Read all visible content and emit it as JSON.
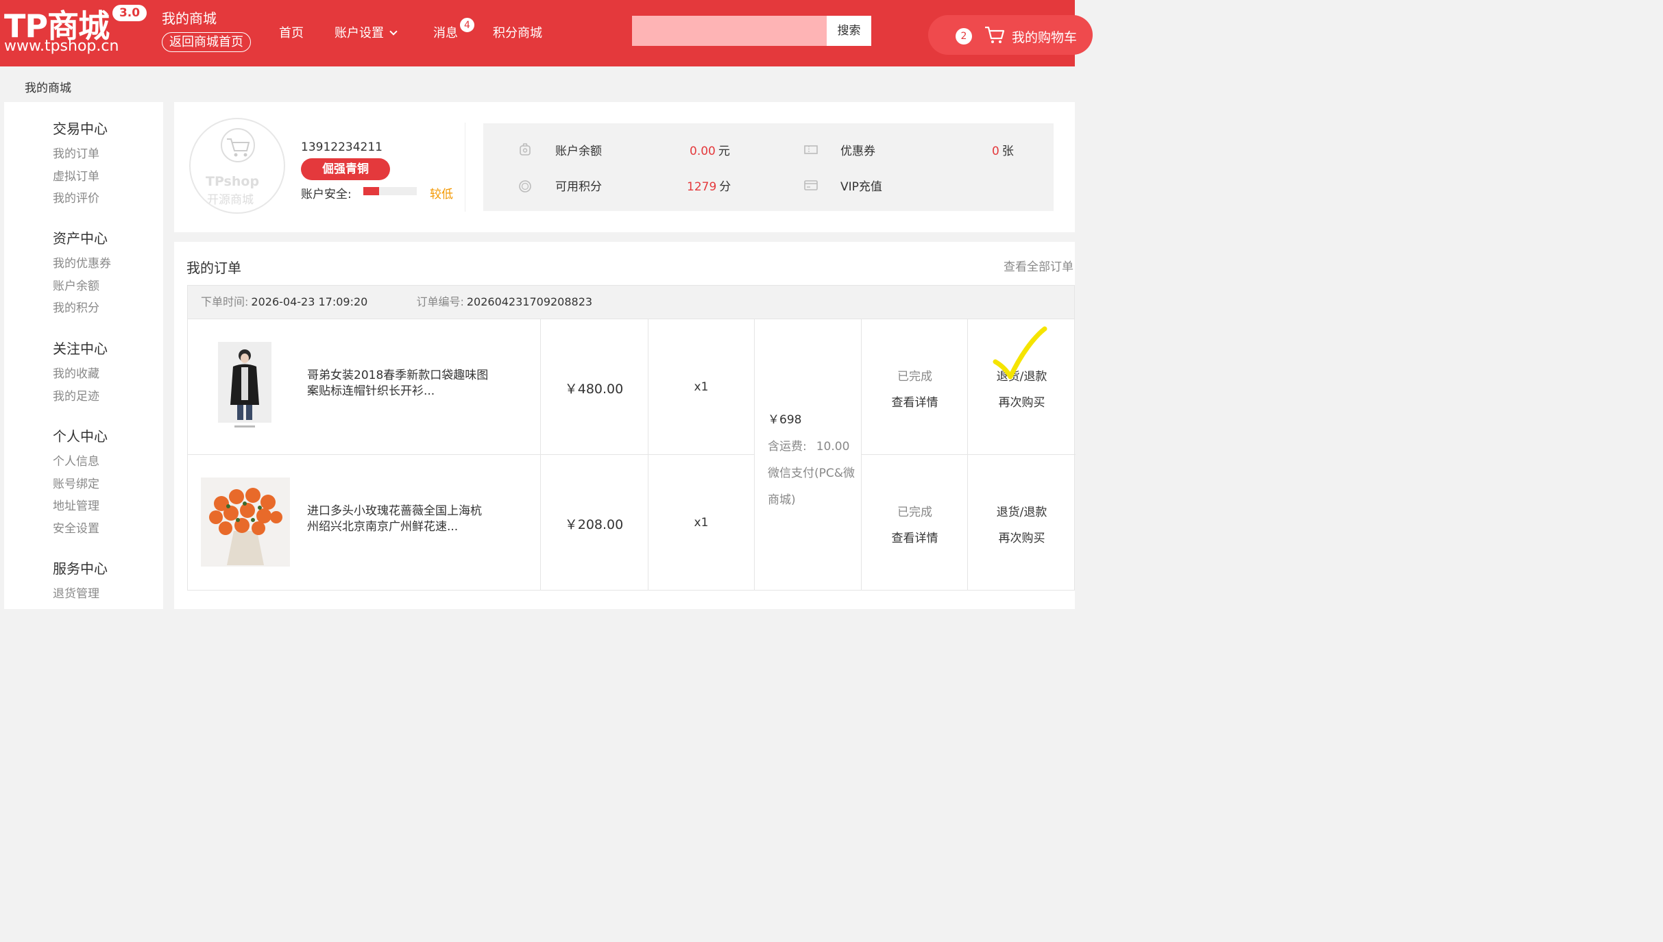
{
  "header": {
    "logo_text": "TP商城",
    "logo_version": "3.0",
    "logo_url": "www.tpshop.cn",
    "mall_title": "我的商城",
    "back_home": "返回商城首页",
    "nav": [
      {
        "label": "首页"
      },
      {
        "label": "账户设置"
      },
      {
        "label": "消息",
        "badge": "4"
      },
      {
        "label": "积分商城"
      }
    ],
    "search": {
      "placeholder": "",
      "button": "搜索"
    },
    "cart": {
      "count": "2",
      "label": "我的购物车"
    },
    "brand_color": "#e4393c"
  },
  "breadcrumb": "我的商城",
  "sidebar": {
    "groups": [
      {
        "title": "交易中心",
        "items": [
          "我的订单",
          "虚拟订单",
          "我的评价"
        ]
      },
      {
        "title": "资产中心",
        "items": [
          "我的优惠券",
          "账户余额",
          "我的积分"
        ]
      },
      {
        "title": "关注中心",
        "items": [
          "我的收藏",
          "我的足迹"
        ]
      },
      {
        "title": "个人中心",
        "items": [
          "个人信息",
          "账号绑定",
          "地址管理",
          "安全设置"
        ]
      },
      {
        "title": "服务中心",
        "items": [
          "退货管理"
        ]
      }
    ]
  },
  "profile": {
    "avatar_logo": "TPshop",
    "avatar_sub": "开源商城",
    "phone": "13912234211",
    "level": "倔强青铜",
    "security_label": "账户安全:",
    "security_level": "较低",
    "security_fraction": 0.3,
    "account": [
      {
        "icon": "balance-icon",
        "label": "账户余额",
        "value": "0.00",
        "unit": "元"
      },
      {
        "icon": "coupon-icon",
        "label": "优惠券",
        "value": "0",
        "unit": "张"
      },
      {
        "icon": "points-icon",
        "label": "可用积分",
        "value": "1279",
        "unit": "分"
      },
      {
        "icon": "card-icon",
        "label": "VIP充值",
        "value": "",
        "unit": ""
      }
    ]
  },
  "orders": {
    "title": "我的订单",
    "view_all": "查看全部订单",
    "time_label": "下单时间:",
    "time_value": "2026-04-23 17:09:20",
    "no_label": "订单编号:",
    "no_value": "202604231709208823",
    "items": [
      {
        "name": "哥弟女装2018春季新款口袋趣味图案贴标连帽针织长开衫...",
        "price": "￥480.00",
        "qty": "x1",
        "status": "已完成",
        "detail": "查看详情",
        "refund": "退货/退款",
        "rebuy": "再次购买"
      },
      {
        "name": "进口多头小玫瑰花蔷薇全国上海杭州绍兴北京南京广州鲜花速...",
        "price": "￥208.00",
        "qty": "x1",
        "status": "已完成",
        "detail": "查看详情",
        "refund": "退货/退款",
        "rebuy": "再次购买"
      }
    ],
    "total": "￥698",
    "shipping_label": "含运费:",
    "shipping_value": "10.00",
    "pay_method": "微信支付(PC&微商城)"
  }
}
